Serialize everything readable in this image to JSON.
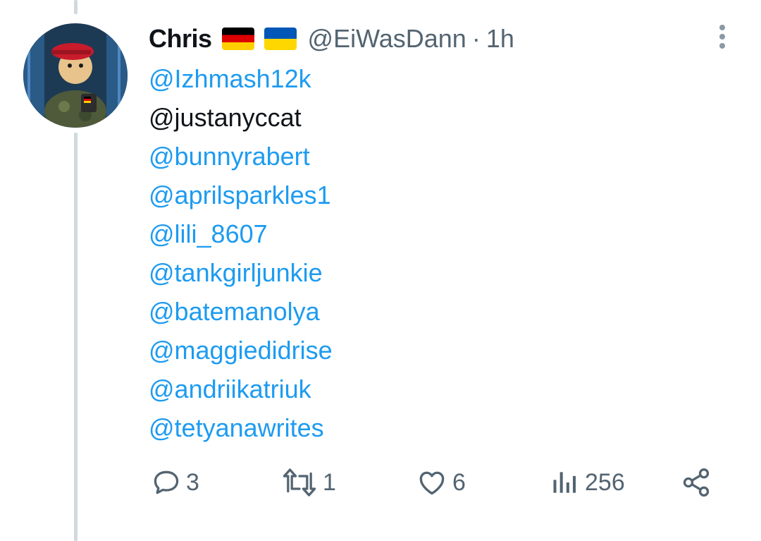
{
  "tweet": {
    "name": "Chris",
    "flags": [
      "germany-flag-icon",
      "ukraine-flag-icon"
    ],
    "handle": "@EiWasDann",
    "separator": "·",
    "time": "1h",
    "mentions": [
      {
        "text": "@Izhmash12k",
        "is_link": true
      },
      {
        "text": "@justanyccat",
        "is_link": false
      },
      {
        "text": "@bunnyrabert",
        "is_link": true
      },
      {
        "text": "@aprilsparkles1",
        "is_link": true
      },
      {
        "text": "@lili_8607",
        "is_link": true
      },
      {
        "text": "@tankgirljunkie",
        "is_link": true
      },
      {
        "text": "@batemanolya",
        "is_link": true
      },
      {
        "text": "@maggiedidrise",
        "is_link": true
      },
      {
        "text": "@andriikatriuk",
        "is_link": true
      },
      {
        "text": "@tetyanawrites",
        "is_link": true
      }
    ],
    "actions": {
      "reply_count": "3",
      "retweet_count": "1",
      "like_count": "6",
      "views_count": "256"
    }
  },
  "colors": {
    "link": "#1d9bf0",
    "text": "#0f1419",
    "secondary": "#536471",
    "thread_line": "#cfd9de"
  }
}
